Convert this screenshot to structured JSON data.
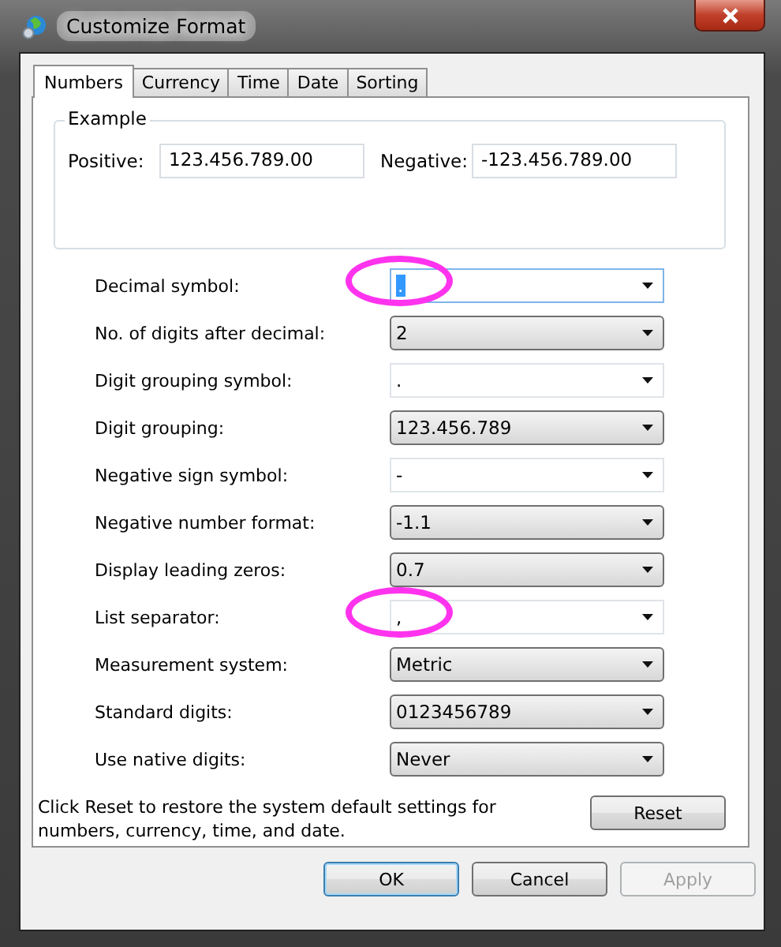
{
  "window": {
    "title": "Customize Format"
  },
  "tabs": [
    {
      "label": "Numbers",
      "selected": true
    },
    {
      "label": "Currency",
      "selected": false
    },
    {
      "label": "Time",
      "selected": false
    },
    {
      "label": "Date",
      "selected": false
    },
    {
      "label": "Sorting",
      "selected": false
    }
  ],
  "example": {
    "title": "Example",
    "positive_label": "Positive:",
    "positive_value": "123.456.789.00",
    "negative_label": "Negative:",
    "negative_value": "-123.456.789.00"
  },
  "settings": [
    {
      "label": "Decimal symbol:",
      "value": ".",
      "kind": "edit",
      "focused": true,
      "circled": true
    },
    {
      "label": "No. of digits after decimal:",
      "value": "2",
      "kind": "list",
      "focused": false,
      "circled": false
    },
    {
      "label": "Digit grouping symbol:",
      "value": ".",
      "kind": "edit",
      "focused": false,
      "circled": false
    },
    {
      "label": "Digit grouping:",
      "value": "123.456.789",
      "kind": "list",
      "focused": false,
      "circled": false
    },
    {
      "label": "Negative sign symbol:",
      "value": "-",
      "kind": "edit",
      "focused": false,
      "circled": false
    },
    {
      "label": "Negative number format:",
      "value": "-1.1",
      "kind": "list",
      "focused": false,
      "circled": false
    },
    {
      "label": "Display leading zeros:",
      "value": "0.7",
      "kind": "list",
      "focused": false,
      "circled": false
    },
    {
      "label": "List separator:",
      "value": ",",
      "kind": "edit",
      "focused": false,
      "circled": true
    },
    {
      "label": "Measurement system:",
      "value": "Metric",
      "kind": "list",
      "focused": false,
      "circled": false
    },
    {
      "label": "Standard digits:",
      "value": "0123456789",
      "kind": "list",
      "focused": false,
      "circled": false
    },
    {
      "label": "Use native digits:",
      "value": "Never",
      "kind": "list",
      "focused": false,
      "circled": false
    }
  ],
  "reset": {
    "text": "Click Reset to restore the system default settings for numbers, currency, time, and date.",
    "button": "Reset"
  },
  "buttons": [
    {
      "label": "OK",
      "default": true,
      "disabled": false
    },
    {
      "label": "Cancel",
      "default": false,
      "disabled": false
    },
    {
      "label": "Apply",
      "default": false,
      "disabled": true
    }
  ]
}
